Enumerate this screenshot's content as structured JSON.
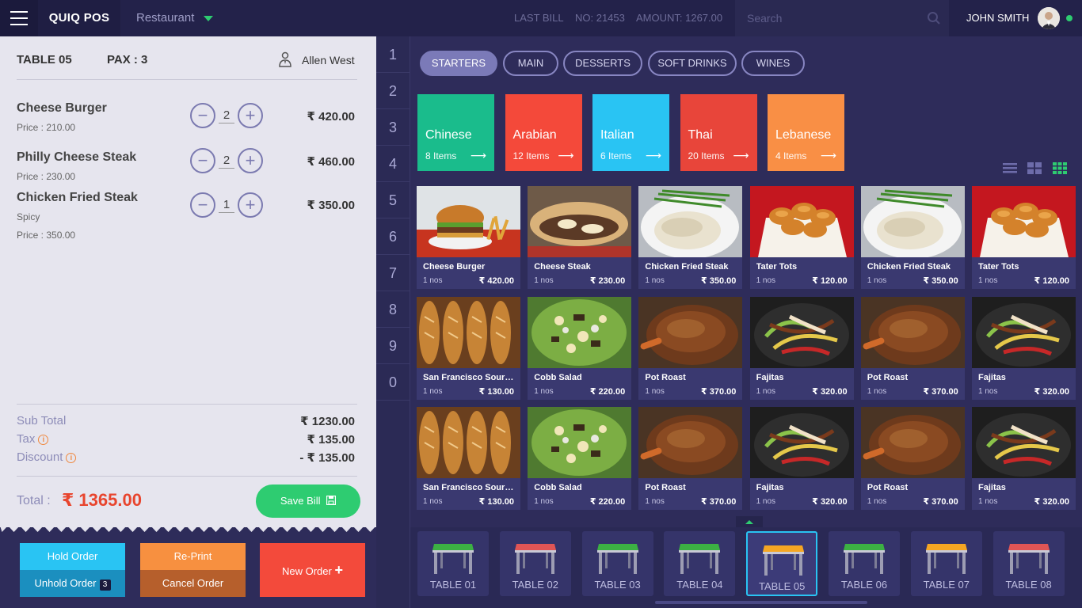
{
  "app": {
    "brand": "QUIQ POS",
    "venue": "Restaurant",
    "last_bill_label": "LAST BILL",
    "last_bill_no": "NO: 21453",
    "last_bill_amount": "AMOUNT: 1267.00",
    "search_placeholder": "Search",
    "user_name": "JOHN SMITH"
  },
  "order": {
    "table": "TABLE 05",
    "pax": "PAX : 3",
    "waiter": "Allen West",
    "items": [
      {
        "name": "Cheese Burger",
        "note": "",
        "price_line": "Price  : 210.00",
        "qty": "2",
        "amount": "₹ 420.00"
      },
      {
        "name": "Philly Cheese Steak",
        "note": "",
        "price_line": "Price  : 230.00",
        "qty": "2",
        "amount": "₹ 460.00"
      },
      {
        "name": "Chicken Fried Steak",
        "note": "Spicy",
        "price_line": "Price  : 350.00",
        "qty": "1",
        "amount": "₹ 350.00"
      }
    ],
    "subtotal_label": "Sub Total",
    "subtotal": "₹ 1230.00",
    "tax_label": "Tax",
    "tax": "₹ 135.00",
    "discount_label": "Discount",
    "discount": "- ₹ 135.00",
    "total_label": "Total :",
    "total": "₹ 1365.00",
    "save_label": "Save Bill"
  },
  "actions": {
    "hold": "Hold Order",
    "unhold": "Unhold Order",
    "unhold_count": "3",
    "reprint": "Re-Print",
    "cancel": "Cancel Order",
    "new_order": "New Order"
  },
  "numpad": [
    "1",
    "2",
    "3",
    "4",
    "5",
    "6",
    "7",
    "8",
    "9",
    "0"
  ],
  "categories": [
    {
      "label": "STARTERS",
      "active": true
    },
    {
      "label": "MAIN",
      "active": false
    },
    {
      "label": "DESSERTS",
      "active": false
    },
    {
      "label": "SOFT DRINKS",
      "active": false
    },
    {
      "label": "WINES",
      "active": false
    }
  ],
  "cuisines": [
    {
      "name": "Chinese",
      "count": "8 Items",
      "color": "#1abc8c"
    },
    {
      "name": "Arabian",
      "count": "12 Items",
      "color": "#f4493a"
    },
    {
      "name": "Italian",
      "count": "6 Items",
      "color": "#29c4f3"
    },
    {
      "name": "Thai",
      "count": "20 Items",
      "color": "#e8453a"
    },
    {
      "name": "Lebanese",
      "count": "4 Items",
      "color": "#f98f45"
    }
  ],
  "products": [
    {
      "name": "Cheese Burger",
      "qty": "1 nos",
      "price": "₹ 420.00",
      "kind": "burger"
    },
    {
      "name": "Cheese Steak",
      "qty": "1 nos",
      "price": "₹ 230.00",
      "kind": "steak_sandwich"
    },
    {
      "name": "Chicken Fried Steak",
      "qty": "1 nos",
      "price": "₹ 350.00",
      "kind": "fried_steak"
    },
    {
      "name": "Tater Tots",
      "qty": "1 nos",
      "price": "₹ 120.00",
      "kind": "tots"
    },
    {
      "name": "Chicken Fried Steak",
      "qty": "1 nos",
      "price": "₹ 350.00",
      "kind": "fried_steak"
    },
    {
      "name": "Tater Tots",
      "qty": "1 nos",
      "price": "₹ 120.00",
      "kind": "tots"
    },
    {
      "name": "San Francisco Sourdough",
      "qty": "1 nos",
      "price": "₹ 130.00",
      "kind": "bread"
    },
    {
      "name": "Cobb Salad",
      "qty": "1 nos",
      "price": "₹ 220.00",
      "kind": "salad"
    },
    {
      "name": "Pot Roast",
      "qty": "1 nos",
      "price": "₹ 370.00",
      "kind": "roast"
    },
    {
      "name": "Fajitas",
      "qty": "1 nos",
      "price": "₹ 320.00",
      "kind": "fajitas"
    },
    {
      "name": "Pot Roast",
      "qty": "1 nos",
      "price": "₹ 370.00",
      "kind": "roast"
    },
    {
      "name": "Fajitas",
      "qty": "1 nos",
      "price": "₹ 320.00",
      "kind": "fajitas"
    },
    {
      "name": "San Francisco Sourdough",
      "qty": "1 nos",
      "price": "₹ 130.00",
      "kind": "bread"
    },
    {
      "name": "Cobb Salad",
      "qty": "1 nos",
      "price": "₹ 220.00",
      "kind": "salad"
    },
    {
      "name": "Pot Roast",
      "qty": "1 nos",
      "price": "₹ 370.00",
      "kind": "roast"
    },
    {
      "name": "Fajitas",
      "qty": "1 nos",
      "price": "₹ 320.00",
      "kind": "fajitas"
    },
    {
      "name": "Pot Roast",
      "qty": "1 nos",
      "price": "₹ 370.00",
      "kind": "roast"
    },
    {
      "name": "Fajitas",
      "qty": "1 nos",
      "price": "₹ 320.00",
      "kind": "fajitas"
    }
  ],
  "tables": [
    {
      "label": "TABLE 01",
      "status_color": "#3cb043",
      "active": false
    },
    {
      "label": "TABLE 02",
      "status_color": "#e05555",
      "active": false
    },
    {
      "label": "TABLE 03",
      "status_color": "#3cb043",
      "active": false
    },
    {
      "label": "TABLE 04",
      "status_color": "#3cb043",
      "active": false
    },
    {
      "label": "TABLE 05",
      "status_color": "#f5a623",
      "active": true
    },
    {
      "label": "TABLE 06",
      "status_color": "#3cb043",
      "active": false
    },
    {
      "label": "TABLE 07",
      "status_color": "#f5a623",
      "active": false
    },
    {
      "label": "TABLE 08",
      "status_color": "#e05555",
      "active": false
    }
  ]
}
